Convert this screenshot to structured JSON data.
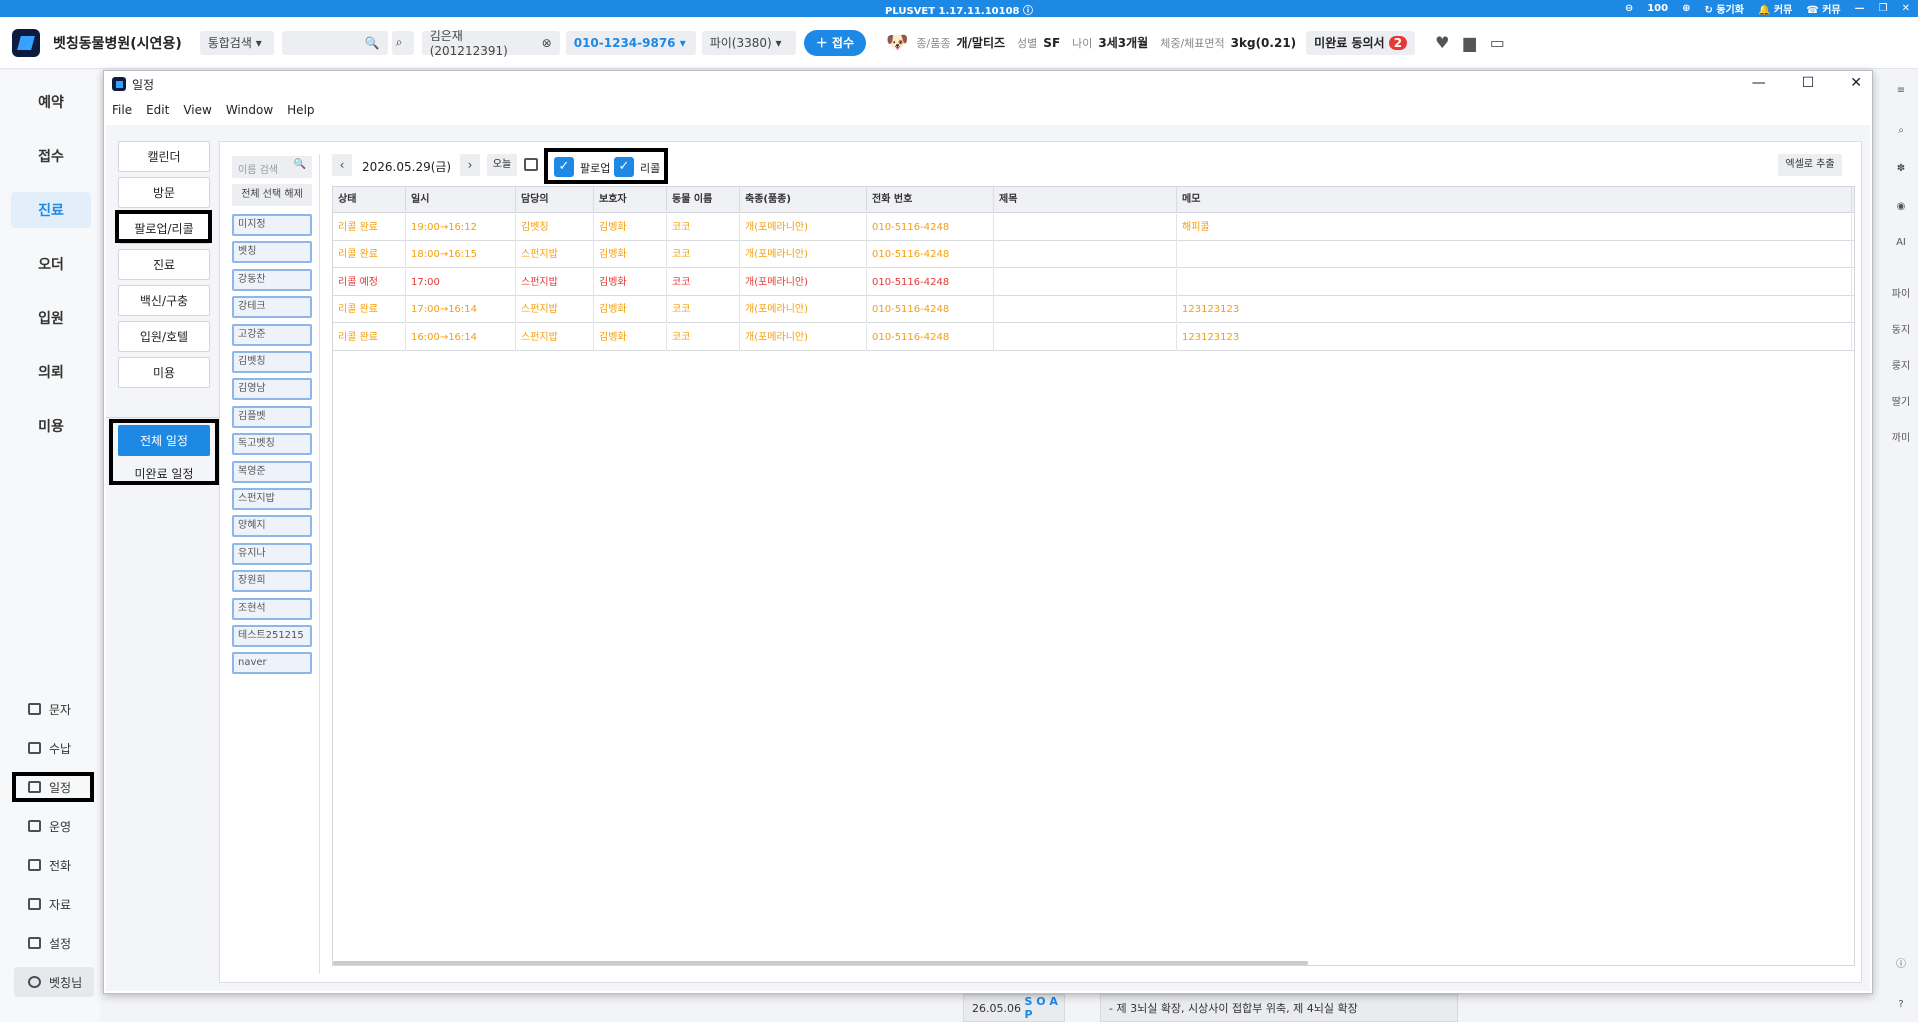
{
  "titlebar": {
    "app": "PLUSVET",
    "version": "1.17.11.10108",
    "zoom": "100",
    "sync": "동기화",
    "bell": "커뮤",
    "phone": "커뮤"
  },
  "topbar": {
    "hospital": "벳칭동물병원(시연용)",
    "search_type": "통합검색",
    "search_placeholder": "",
    "patient": "김은재(201212391)",
    "phone": "010-1234-9876",
    "pet": "파이(3380)",
    "register": "접수",
    "species_label": "종/품종",
    "species": "개/말티즈",
    "sex_label": "성별",
    "sex": "SF",
    "age_label": "나이",
    "age": "3세3개월",
    "weight_label": "체중/체표면적",
    "weight": "3kg(0.21)",
    "consent": "미완료 동의서",
    "consent_count": "2"
  },
  "leftnav": {
    "main": [
      "예약",
      "접수",
      "진료",
      "오더",
      "입원",
      "의뢰",
      "미용"
    ],
    "active": "진료",
    "sub": [
      "문자",
      "수납",
      "일정",
      "운영",
      "전화",
      "자료",
      "설정",
      "벳칭님"
    ]
  },
  "rightbar": {
    "labels": [
      "파이",
      "동지",
      "룽지",
      "딸기",
      "까미"
    ]
  },
  "window": {
    "title": "일정",
    "menu": [
      "File",
      "Edit",
      "View",
      "Window",
      "Help"
    ]
  },
  "categories": [
    "캘린더",
    "방문",
    "팔로업/리콜",
    "진료",
    "백신/구충",
    "입원/호텔",
    "미용"
  ],
  "schedule_filters": [
    "전체 일정",
    "미완료 일정"
  ],
  "names": {
    "search_placeholder": "이름 검색",
    "deselect": "전체 선택 해제",
    "list": [
      "미지정",
      "벳칭",
      "강동찬",
      "강테크",
      "고강준",
      "김벳칭",
      "김영남",
      "김플벳",
      "독고벳칭",
      "복영준",
      "스펀지밥",
      "양혜지",
      "유지나",
      "장원희",
      "조현석",
      "테스트251215",
      "naver"
    ]
  },
  "toolbar": {
    "date": "2026.05.29(금)",
    "today": "오늘",
    "followup": "팔로업",
    "recall": "리콜",
    "excel": "엑셀로 추출"
  },
  "table": {
    "headers": [
      "상태",
      "일시",
      "담당의",
      "보호자",
      "동물 이름",
      "축종(품종)",
      "전화 번호",
      "제목",
      "메모"
    ],
    "rows": [
      [
        "리콜 완료",
        "19:00→16:12",
        "김벳칭",
        "김벵화",
        "코코",
        "개(포메라니안)",
        "010-5116-4248",
        "",
        "해피콜"
      ],
      [
        "리콜 완료",
        "18:00→16:15",
        "스펀지밥",
        "김벵화",
        "코코",
        "개(포메라니안)",
        "010-5116-4248",
        "",
        ""
      ],
      [
        "리콜 예정",
        "17:00",
        "스펀지밥",
        "김벵화",
        "코코",
        "개(포메라니안)",
        "010-5116-4248",
        "",
        ""
      ],
      [
        "리콜 완료",
        "17:00→16:14",
        "스펀지밥",
        "김벵화",
        "코코",
        "개(포메라니안)",
        "010-5116-4248",
        "",
        "123123123"
      ],
      [
        "리콜 완료",
        "16:00→16:14",
        "스펀지밥",
        "김벵화",
        "코코",
        "개(포메라니안)",
        "010-5116-4248",
        "",
        "123123123"
      ]
    ],
    "row_colors": [
      "#f59e0b",
      "#f59e0b",
      "#e53935",
      "#f59e0b",
      "#f59e0b"
    ]
  },
  "background": {
    "soap_date": "26.05.06",
    "soap": "S O A P",
    "note": "- 제 3뇌실 확장, 시상사이 접합부 위축, 제 4뇌실 확장"
  }
}
